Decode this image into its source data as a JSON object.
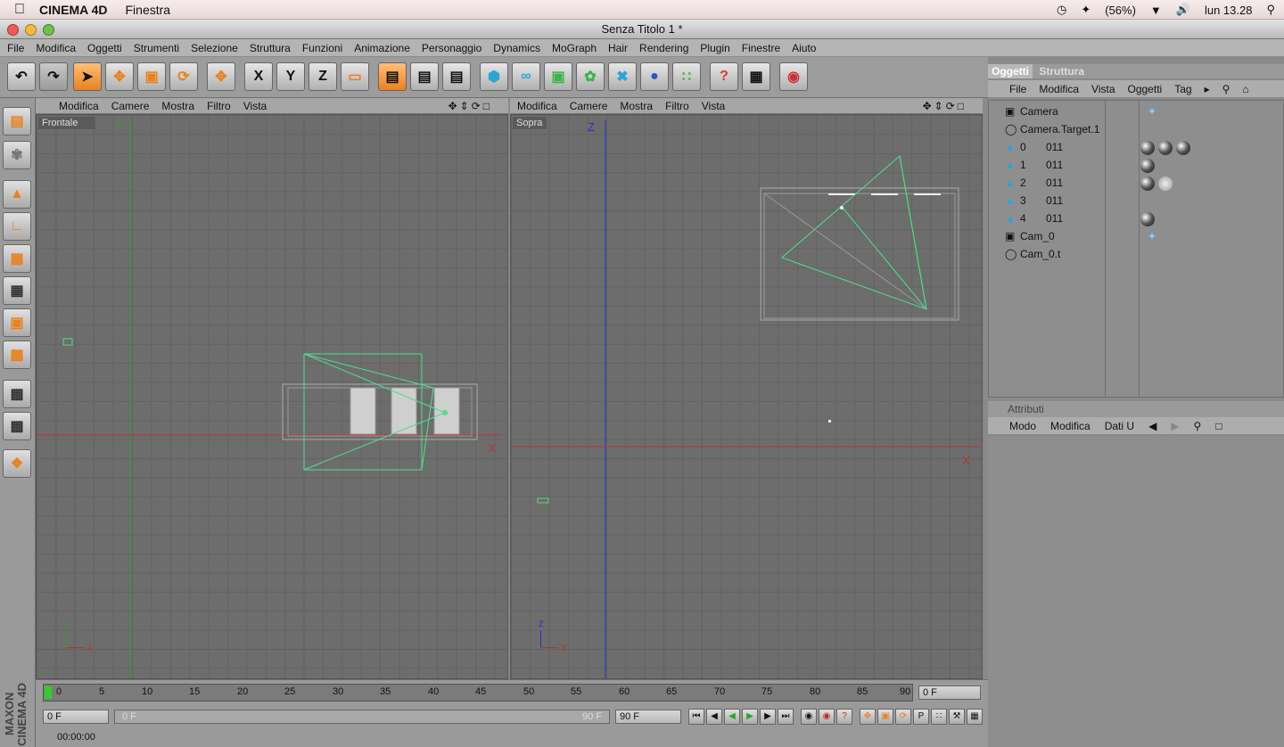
{
  "mac_menu": {
    "app_name": "CINEMA 4D",
    "menu": "Finestra",
    "battery": "(56%)",
    "clock": "lun 13.28"
  },
  "window": {
    "title": "Senza Titolo 1 *"
  },
  "menubar": [
    "File",
    "Modifica",
    "Oggetti",
    "Strumenti",
    "Selezione",
    "Struttura",
    "Funzioni",
    "Animazione",
    "Personaggio",
    "Dynamics",
    "MoGraph",
    "Hair",
    "Rendering",
    "Plugin",
    "Finestre",
    "Aiuto"
  ],
  "toolbar": {
    "x_label": "X",
    "y_label": "Y",
    "z_label": "Z"
  },
  "viewport_menu": [
    "Modifica",
    "Camere",
    "Mostra",
    "Filtro",
    "Vista"
  ],
  "viewports": [
    {
      "label": "Frontale",
      "axis_v": "Y",
      "axis_h": "X",
      "mini_v": "Y",
      "mini_h": "X"
    },
    {
      "label": "Sopra",
      "axis_v": "Z",
      "axis_h": "X",
      "mini_v": "Z",
      "mini_h": "X"
    }
  ],
  "object_manager": {
    "tabs": [
      "Oggetti",
      "Struttura"
    ],
    "menu": [
      "File",
      "Modifica",
      "Vista",
      "Oggetti",
      "Tag"
    ],
    "objects": [
      {
        "name": "Camera",
        "tag": ""
      },
      {
        "name": "Camera.Target.1",
        "tag": ""
      },
      {
        "name": "0",
        "tag": "011"
      },
      {
        "name": "1",
        "tag": "011"
      },
      {
        "name": "2",
        "tag": "011"
      },
      {
        "name": "3",
        "tag": "011"
      },
      {
        "name": "4",
        "tag": "011"
      },
      {
        "name": "Cam_0",
        "tag": ""
      },
      {
        "name": "Cam_0.t",
        "tag": ""
      }
    ]
  },
  "attributes": {
    "title": "Attributi",
    "menu": [
      "Modo",
      "Modifica",
      "Dati U"
    ]
  },
  "timeline": {
    "ticks": [
      "0",
      "5",
      "10",
      "15",
      "20",
      "25",
      "30",
      "35",
      "40",
      "45",
      "50",
      "55",
      "60",
      "65",
      "70",
      "75",
      "80",
      "85",
      "90"
    ],
    "current_frame": "0 F",
    "start_frame": "0 F",
    "range_start": "0 F",
    "range_end": "90 F",
    "end_frame": "90 F",
    "time": "00:00:00"
  },
  "branding": "MAXON CINEMA 4D"
}
